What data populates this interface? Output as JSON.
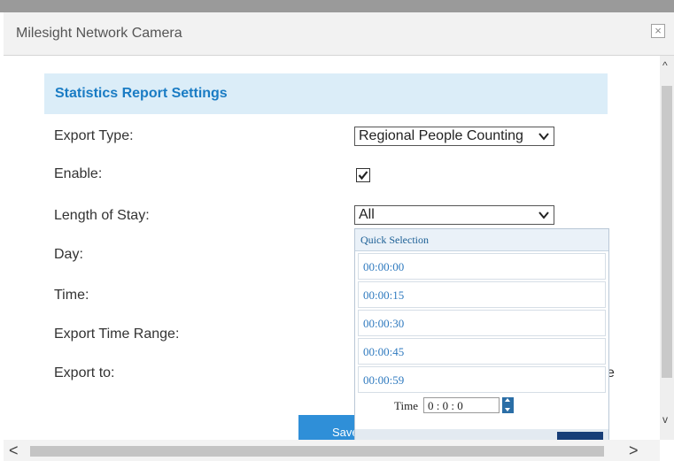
{
  "window": {
    "title": "Milesight Network Camera",
    "close_icon": "close-icon"
  },
  "section": {
    "title": "Statistics Report Settings"
  },
  "form": {
    "export_type_label": "Export Type:",
    "export_type_value": "Regional People Counting",
    "enable_label": "Enable:",
    "enable_checked": true,
    "length_of_stay_label": "Length of Stay:",
    "length_of_stay_value": "All",
    "day_label": "Day:",
    "time_label": "Time:",
    "export_time_range_label": "Export Time Range:",
    "export_to_label": "Export to:",
    "export_to_partial_text": "e"
  },
  "dropdown": {
    "header": "Quick Selection",
    "options": [
      "00:00:00",
      "00:00:15",
      "00:00:30",
      "00:00:45",
      "00:00:59"
    ],
    "time_label": "Time",
    "time_value": "0 : 0 : 0"
  },
  "buttons": {
    "save_label": "Save"
  },
  "colors": {
    "accent": "#1a7cc4",
    "header_bg": "#dbedf8",
    "button": "#2f8fd8"
  },
  "scroll": {
    "up": "^",
    "down": "v",
    "left": "<",
    "right": ">"
  }
}
